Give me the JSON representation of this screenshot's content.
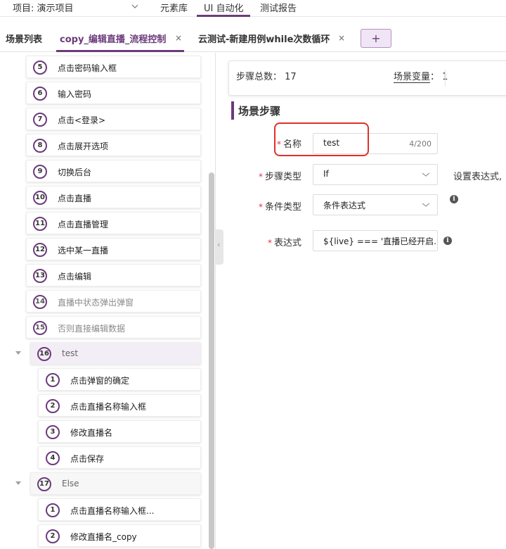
{
  "header": {
    "project": "项目: 演示项目",
    "nav": [
      "元素库",
      "UI 自动化",
      "测试报告"
    ],
    "active_nav": "UI 自动化"
  },
  "tabs": {
    "scene_list": "场景列表",
    "items": [
      {
        "label": "copy_编辑直播_流程控制",
        "active": true
      },
      {
        "label": "云测试-新建用例while次数循环",
        "active": false
      }
    ],
    "close_glyph": "×",
    "add_glyph": "+"
  },
  "tree": {
    "steps": [
      {
        "num": "5",
        "label": "点击密码输入框"
      },
      {
        "num": "6",
        "label": "输入密码"
      },
      {
        "num": "7",
        "label": "点击<登录>"
      },
      {
        "num": "8",
        "label": "点击展开选项"
      },
      {
        "num": "9",
        "label": "切换后台"
      },
      {
        "num": "10",
        "label": "点击直播"
      },
      {
        "num": "11",
        "label": "点击直播管理"
      },
      {
        "num": "12",
        "label": "选中某一直播"
      },
      {
        "num": "13",
        "label": "点击编辑"
      },
      {
        "num": "14",
        "label": "直播中状态弹出弹窗"
      },
      {
        "num": "15",
        "label": "否则直接编辑数据"
      }
    ],
    "group_if": {
      "num": "16",
      "label": "test"
    },
    "if_children": [
      {
        "num": "1",
        "label": "点击弹窗的确定"
      },
      {
        "num": "2",
        "label": "点击直播名称输入框"
      },
      {
        "num": "3",
        "label": "修改直播名"
      },
      {
        "num": "4",
        "label": "点击保存"
      }
    ],
    "group_else": {
      "num": "17",
      "label": "Else"
    },
    "else_children": [
      {
        "num": "1",
        "label": "点击直播名称输入框..."
      },
      {
        "num": "2",
        "label": "修改直播名_copy"
      }
    ]
  },
  "summary": {
    "steps_total_label": "步骤总数：",
    "steps_total": "17",
    "scene_vars_label": "场景变量",
    "scene_vars_colon": "：",
    "scene_vars": "1"
  },
  "section": {
    "title": "场景步骤"
  },
  "form": {
    "name": {
      "label": "名称",
      "value": "test",
      "counter": "4/200"
    },
    "step_type": {
      "label": "步骤类型",
      "value": "If",
      "hint": "设置表达式,"
    },
    "condition_type": {
      "label": "条件类型",
      "value": "条件表达式"
    },
    "expression": {
      "label": "表达式",
      "value": "${live} === '直播已经开启."
    },
    "required_mark": "*",
    "info_glyph": "i"
  },
  "colors": {
    "accent": "#6b3b7b",
    "highlight": "#e0302a",
    "required": "#e0334b"
  }
}
